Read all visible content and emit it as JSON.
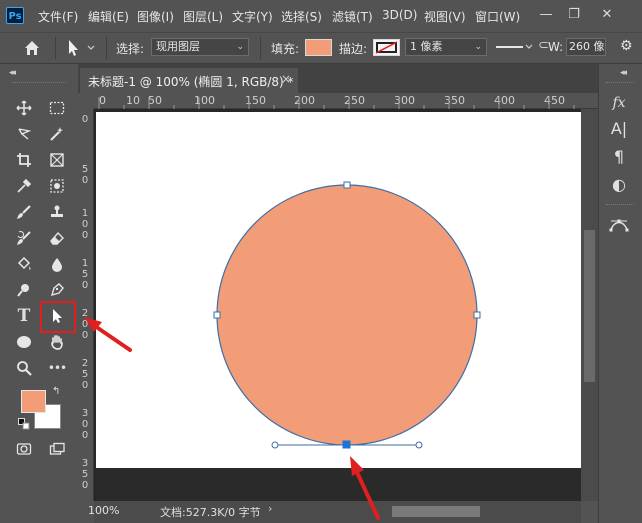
{
  "app": {
    "logo": "Ps"
  },
  "menu": [
    "文件(F)",
    "编辑(E)",
    "图像(I)",
    "图层(L)",
    "文字(Y)",
    "选择(S)",
    "滤镜(T)",
    "3D(D)",
    "视图(V)",
    "窗口(W)"
  ],
  "window_controls": {
    "minimize": "—",
    "restore": "❐",
    "close": "✕"
  },
  "options_bar": {
    "select_label": "选择:",
    "select_value": "现用图层",
    "fill_label": "填充:",
    "fill_color": "#f29d77",
    "stroke_label": "描边:",
    "stroke_width": "1 像素",
    "width_label": "W:",
    "width_value": "260 像"
  },
  "document": {
    "tab_title": "未标题-1 @ 100% (椭圆 1, RGB/8) *",
    "close": "×",
    "canvas_color": "#ffffff",
    "ellipse_fill": "#f29d77",
    "ellipse_stroke": "#3e6ea6"
  },
  "ruler": {
    "top": [
      "0",
      "10",
      "50",
      "100",
      "150",
      "200",
      "250",
      "300",
      "350",
      "400",
      "450"
    ],
    "left": [
      [
        "0"
      ],
      [
        "5",
        "0"
      ],
      [
        "1",
        "0",
        "0"
      ],
      [
        "1",
        "5",
        "0"
      ],
      [
        "2",
        "0",
        "0"
      ],
      [
        "2",
        "5",
        "0"
      ],
      [
        "3",
        "0",
        "0"
      ],
      [
        "3",
        "5",
        "0"
      ]
    ]
  },
  "status": {
    "zoom": "100%",
    "doc_info": "文档:527.3K/0 字节",
    "chevron": "›"
  },
  "tools": {
    "active": "path-selection-tool",
    "foreground_color": "#f29d77",
    "background_color": "#ffffff",
    "more_label": "•••"
  },
  "right_panel": [
    "fx",
    "A|",
    "¶",
    "◐"
  ],
  "annotations": {
    "arrow_color": "#e02020"
  }
}
